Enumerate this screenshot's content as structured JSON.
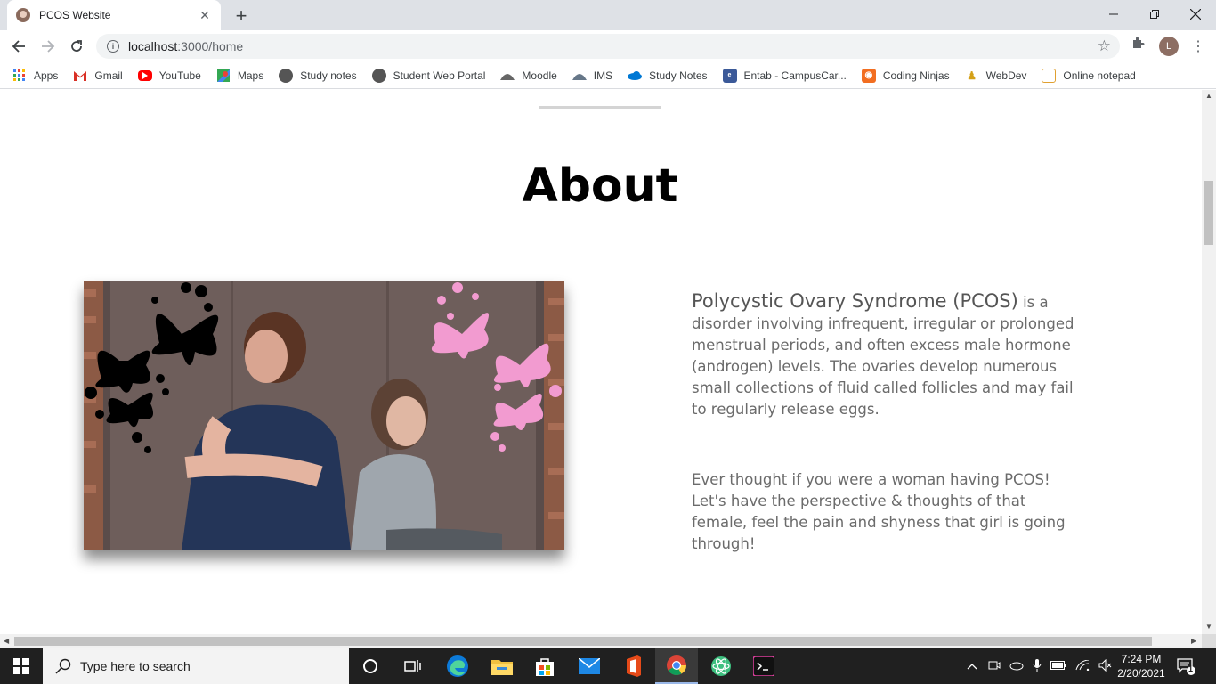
{
  "browser": {
    "tab_title": "PCOS Website",
    "tab_close": "✕",
    "new_tab": "+",
    "url_host": "localhost",
    "url_rest": ":3000/home",
    "avatar_letter": "L"
  },
  "bookmarks": [
    {
      "label": "Apps",
      "icon": "apps-grid-icon",
      "color": "#4285f4"
    },
    {
      "label": "Gmail",
      "icon": "gmail-icon",
      "color": "#d93025"
    },
    {
      "label": "YouTube",
      "icon": "youtube-icon",
      "color": "#ff0000"
    },
    {
      "label": "Maps",
      "icon": "maps-icon",
      "color": "#34a853"
    },
    {
      "label": "Study notes",
      "icon": "globe-icon",
      "color": "#555555"
    },
    {
      "label": "Student Web Portal",
      "icon": "globe-icon",
      "color": "#555555"
    },
    {
      "label": "Moodle",
      "icon": "moodle-icon",
      "color": "#666666"
    },
    {
      "label": "IMS",
      "icon": "ims-icon",
      "color": "#666666"
    },
    {
      "label": "Study Notes",
      "icon": "onedrive-icon",
      "color": "#0078d4"
    },
    {
      "label": "Entab - CampusCar...",
      "icon": "entab-icon",
      "color": "#3b5998"
    },
    {
      "label": "Coding Ninjas",
      "icon": "coding-ninjas-icon",
      "color": "#f26e21"
    },
    {
      "label": "WebDev",
      "icon": "webdev-icon",
      "color": "#d4a017"
    },
    {
      "label": "Online notepad",
      "icon": "notepad-icon",
      "color": "#e0a030"
    }
  ],
  "page": {
    "heading": "About",
    "lead": "Polycystic Ovary Syndrome (PCOS)",
    "lead_rest": " is a disorder involving infrequent, irregular or prolonged menstrual periods, and often excess male hormone (androgen) levels. The ovaries develop numerous small collections of fluid called follicles and may fail to regularly release eggs.",
    "secondary": "Ever thought if you were a woman having PCOS! Let's have the perspective & thoughts of that female, feel the pain and shyness that girl is going through!"
  },
  "taskbar": {
    "search_placeholder": "Type here to search",
    "time": "7:24 PM",
    "date": "2/20/2021",
    "notification_count": "1"
  }
}
